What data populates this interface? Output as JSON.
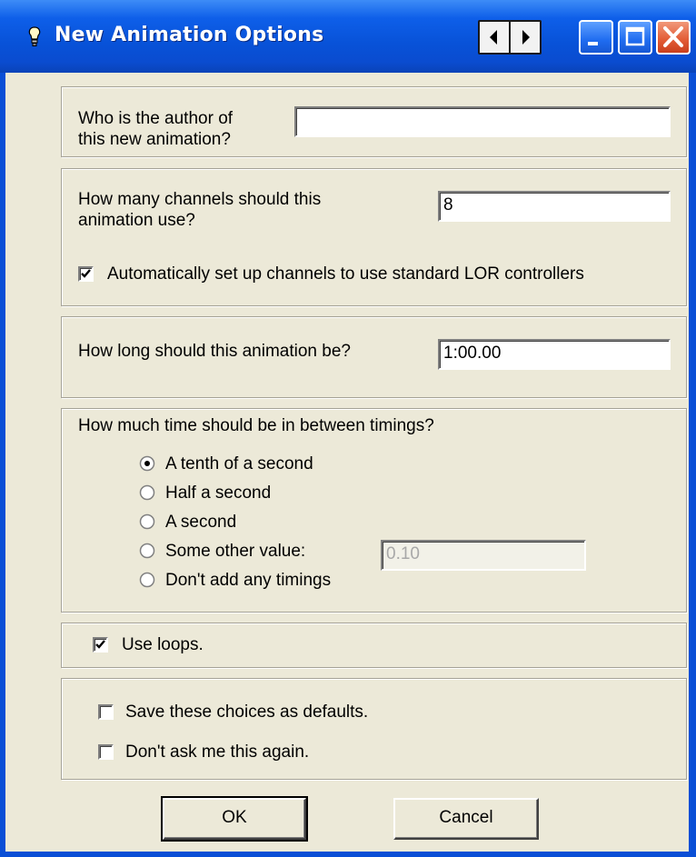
{
  "window": {
    "title": "New Animation Options",
    "icon": "lightbulb-icon",
    "accent": "#0a4fd6",
    "face_color": "#ece9d8"
  },
  "author": {
    "label_line1": "Who is the author of",
    "label_line2": "this new animation?",
    "value": ""
  },
  "channels": {
    "label_line1": "How many channels should this",
    "label_line2": "animation use?",
    "value": "8",
    "auto_setup_label": "Automatically set up channels to use standard LOR controllers",
    "auto_setup_checked": true
  },
  "length": {
    "label": "How long should this animation be?",
    "value": "1:00.00"
  },
  "timings": {
    "label": "How much time should be in between timings?",
    "options": [
      {
        "label": "A tenth of a second",
        "selected": true
      },
      {
        "label": "Half a second",
        "selected": false
      },
      {
        "label": "A second",
        "selected": false
      },
      {
        "label": "Some other value:",
        "selected": false
      },
      {
        "label": "Don't add any timings",
        "selected": false
      }
    ],
    "other_value": "0.10"
  },
  "loops": {
    "label": "Use loops.",
    "checked": true
  },
  "defaults": {
    "save_label": "Save these choices as defaults.",
    "save_checked": false,
    "dont_ask_label": "Don't ask me this again.",
    "dont_ask_checked": false
  },
  "buttons": {
    "ok": "OK",
    "cancel": "Cancel"
  }
}
